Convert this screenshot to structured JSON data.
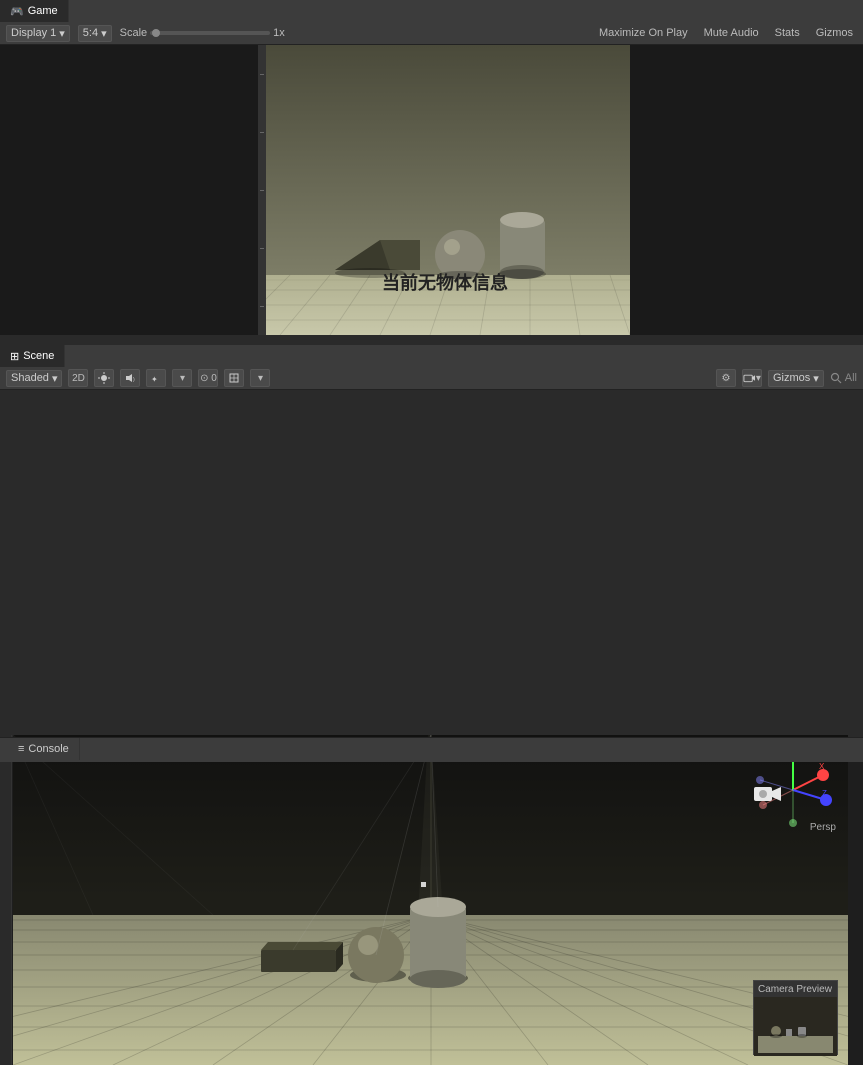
{
  "game_tab": {
    "icon": "🎮",
    "label": "Game"
  },
  "game_toolbar": {
    "display_label": "Display 1",
    "display_dropdown_arrow": "▾",
    "resolution_label": "5:4",
    "resolution_dropdown_arrow": "▾",
    "scale_label": "Scale",
    "scale_value": "1x",
    "maximize_on_play": "Maximize On Play",
    "mute_audio": "Mute Audio",
    "stats": "Stats",
    "gizmos": "Gizmos"
  },
  "game_viewport": {
    "overlay_text": "当前无物体信息"
  },
  "scene_tab": {
    "icon": "⊞",
    "label": "Scene"
  },
  "scene_toolbar": {
    "shaded_label": "Shaded",
    "shaded_dropdown_arrow": "▾",
    "mode_2d": "2D",
    "extras_dropdown_arrow": "▾",
    "gizmos_label": "Gizmos",
    "gizmos_dropdown_arrow": "▾",
    "search_placeholder": "All"
  },
  "camera_preview": {
    "title": "Camera Preview"
  },
  "gizmo": {
    "label": "Persp"
  },
  "console_tab": {
    "icon": "≡",
    "label": "Console"
  }
}
